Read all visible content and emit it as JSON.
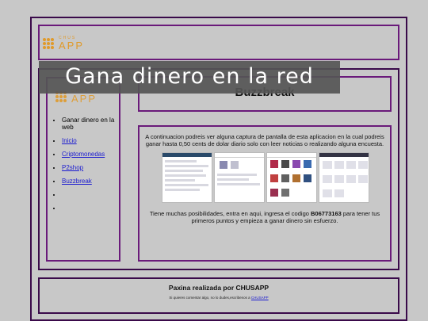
{
  "logo": {
    "small": "CHUS",
    "big": "APP"
  },
  "banner": {
    "text": "Gana dinero en la red"
  },
  "title": "Buzzbreak",
  "sidebar": {
    "items": [
      {
        "label": "Ganar dinero en la web",
        "link": false
      },
      {
        "label": "Inicio",
        "link": true
      },
      {
        "label": "Criptomonedas",
        "link": true
      },
      {
        "label": "P2shop",
        "link": true
      },
      {
        "label": "Buzzbreak",
        "link": true
      },
      {
        "label": "",
        "link": false
      },
      {
        "label": "",
        "link": false
      }
    ]
  },
  "content": {
    "intro": "A continuacion podreis ver alguna captura de pantalla de esta aplicacion en la cual podreis ganar hasta 0,50 cents de dolar diario solo con leer noticias o realizando alguna encuesta.",
    "outro_before": "Tiene muchas posibilidades, entra en aqui, ingresa el codigo ",
    "code": "B06773163",
    "outro_after": " para tener tus primeros puntos y empieza a ganar dinero sin esfuerzo."
  },
  "footer": {
    "title": "Paxina realizada por CHUSAPP",
    "note_before": "Si quieres comentar algo, no lo dudes,escribenos a ",
    "note_link": "CHUSAPP"
  }
}
